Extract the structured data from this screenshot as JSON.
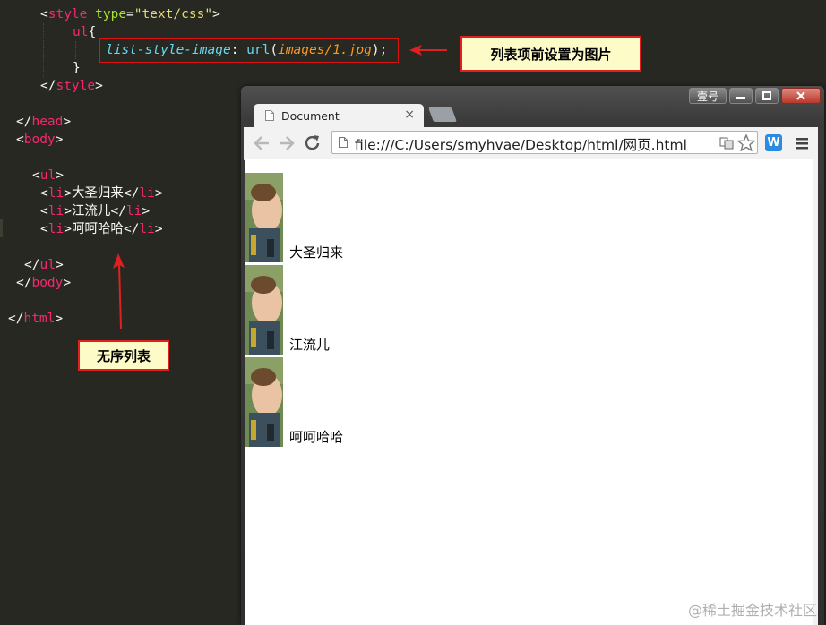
{
  "editor": {
    "line1": {
      "open": "<",
      "tag": "style",
      "attr": "type",
      "eq": "=",
      "val": "\"text/css\"",
      "close": ">"
    },
    "line2": {
      "sel": "ul",
      "brace": "{"
    },
    "line3": {
      "prop": "list-style-image",
      "colon": ": ",
      "fn": "url",
      "paren_open": "(",
      "arg": "images/1.jpg",
      "paren_close": ")",
      "semi": ";"
    },
    "line4": {
      "brace": "}"
    },
    "line5": {
      "open": "</",
      "tag": "style",
      "close": ">"
    },
    "line6": {
      "open": "</",
      "tag": "head",
      "close": ">"
    },
    "line7": {
      "open": "<",
      "tag": "body",
      "close": ">"
    },
    "line8": {
      "open": "<",
      "tag": "ul",
      "close": ">"
    },
    "items": [
      {
        "open": "<",
        "tag": "li",
        "close": ">",
        "text": "大圣归来",
        "eopen": "</",
        "etag": "li",
        "eclose": ">"
      },
      {
        "open": "<",
        "tag": "li",
        "close": ">",
        "text": "江流儿",
        "eopen": "</",
        "etag": "li",
        "eclose": ">"
      },
      {
        "open": "<",
        "tag": "li",
        "close": ">",
        "text": "呵呵哈哈",
        "eopen": "</",
        "etag": "li",
        "eclose": ">"
      }
    ],
    "line12": {
      "open": "</",
      "tag": "ul",
      "close": ">"
    },
    "line13": {
      "open": "</",
      "tag": "body",
      "close": ">"
    },
    "line14": {
      "open": "</",
      "tag": "html",
      "close": ">"
    }
  },
  "annotations": {
    "callout_top": "列表项前设置为图片",
    "callout_bottom": "无序列表",
    "accent": "#e02020"
  },
  "browser": {
    "tab_title": "Document",
    "tab_close": "×",
    "win_label": "壹号",
    "url": "file:///C:/Users/smyhvae/Desktop/html/网页.html",
    "icons": [
      "page-icon",
      "back-icon",
      "forward-icon",
      "reload-icon",
      "translate-icon",
      "star-icon",
      "extension-icon",
      "menu-icon"
    ],
    "list_items": [
      "大圣归来",
      "江流儿",
      "呵呵哈哈"
    ]
  },
  "watermark": "@稀土掘金技术社区"
}
